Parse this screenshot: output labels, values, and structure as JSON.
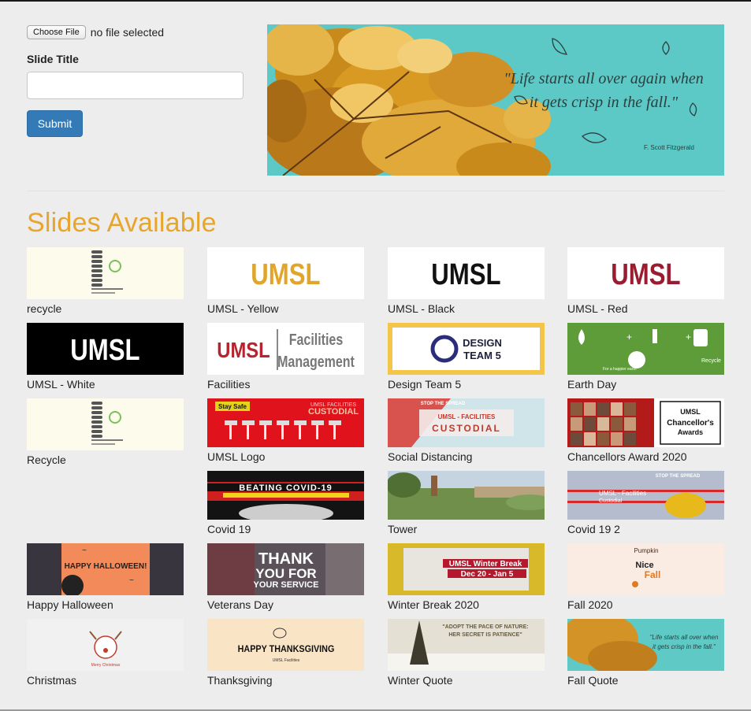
{
  "upload": {
    "choose_file_label": "Choose File",
    "file_status": "no file selected",
    "slide_title_label": "Slide Title",
    "slide_title_value": "",
    "submit_label": "Submit"
  },
  "preview": {
    "quote_line1": "\"Life starts all over again when",
    "quote_line2": "it gets crisp in the fall.\"",
    "author": "F. Scott Fitzgerald"
  },
  "section_heading": "Slides Available",
  "slides": [
    {
      "label": "recycle",
      "thumb": {
        "style": "recycle"
      }
    },
    {
      "label": "UMSL - Yellow",
      "thumb": {
        "style": "umsl",
        "text": "UMSL",
        "color": "#e0a52a"
      }
    },
    {
      "label": "UMSL - Black",
      "thumb": {
        "style": "umsl",
        "text": "UMSL",
        "color": "#111111"
      }
    },
    {
      "label": "UMSL - Red",
      "thumb": {
        "style": "umsl",
        "text": "UMSL",
        "color": "#9b1b30"
      }
    },
    {
      "label": "UMSL - White",
      "thumb": {
        "style": "umsl-white",
        "text": "UMSL"
      }
    },
    {
      "label": "Facilities",
      "thumb": {
        "style": "facilities",
        "text": "UMSL",
        "text2": "Facilities",
        "text3": "Management"
      }
    },
    {
      "label": "Design Team 5",
      "thumb": {
        "style": "design",
        "text": "DESIGN",
        "text2": "TEAM 5"
      }
    },
    {
      "label": "Earth Day",
      "thumb": {
        "style": "earth",
        "text": "Recycle",
        "text2": "For a happier earth"
      }
    },
    {
      "label": "Recycle",
      "thumb": {
        "style": "recycle"
      }
    },
    {
      "label": "UMSL Logo",
      "thumb": {
        "style": "custodial-red",
        "text": "Stay Safe",
        "text2": "UMSL FACILITIES",
        "text3": "CUSTODIAL"
      }
    },
    {
      "label": "Social Distancing",
      "thumb": {
        "style": "social",
        "text": "UMSL - FACILITIES",
        "text2": "CUSTODIAL",
        "text3": "STOP THE SPREAD"
      }
    },
    {
      "label": "Chancellors Award 2020",
      "thumb": {
        "style": "chancellor",
        "text": "UMSL",
        "text2": "Chancellor's",
        "text3": "Awards"
      }
    },
    {
      "label": "Covid 19",
      "thumb": {
        "style": "covid",
        "text": "BEATING COVID-19"
      }
    },
    {
      "label": "Tower",
      "thumb": {
        "style": "tower"
      }
    },
    {
      "label": "Covid 19 2",
      "thumb": {
        "style": "covid2",
        "text": "STOP THE SPREAD",
        "text2": "UMSL - Facilities",
        "text3": "Custodial"
      }
    },
    {
      "label": "Happy Halloween",
      "thumb": {
        "style": "halloween",
        "text": "HAPPY HALLOWEEN!"
      }
    },
    {
      "label": "Veterans Day",
      "thumb": {
        "style": "veterans",
        "text": "THANK",
        "text2": "YOU FOR",
        "text3": "YOUR SERVICE"
      }
    },
    {
      "label": "Winter Break 2020",
      "thumb": {
        "style": "winter",
        "text": "UMSL Winter Break",
        "text2": "Dec 20 - Jan 5"
      }
    },
    {
      "label": "Fall 2020",
      "thumb": {
        "style": "fall2020",
        "text": "Nice",
        "text2": "Fall"
      }
    },
    {
      "label": "Christmas",
      "thumb": {
        "style": "christmas",
        "text": "Merry Christmas"
      }
    },
    {
      "label": "Thanksgiving",
      "thumb": {
        "style": "thanksgiving",
        "text": "HAPPY THANKSGIVING",
        "text2": "UMSL Facilities"
      }
    },
    {
      "label": "Winter Quote",
      "thumb": {
        "style": "winterquote",
        "text": "\"ADOPT THE PACE OF NATURE:",
        "text2": "HER SECRET IS PATIENCE\""
      }
    },
    {
      "label": "Fall Quote",
      "thumb": {
        "style": "fallquote",
        "text": "\"Life starts all over when",
        "text2": "it gets crisp in the fall.\""
      }
    }
  ]
}
